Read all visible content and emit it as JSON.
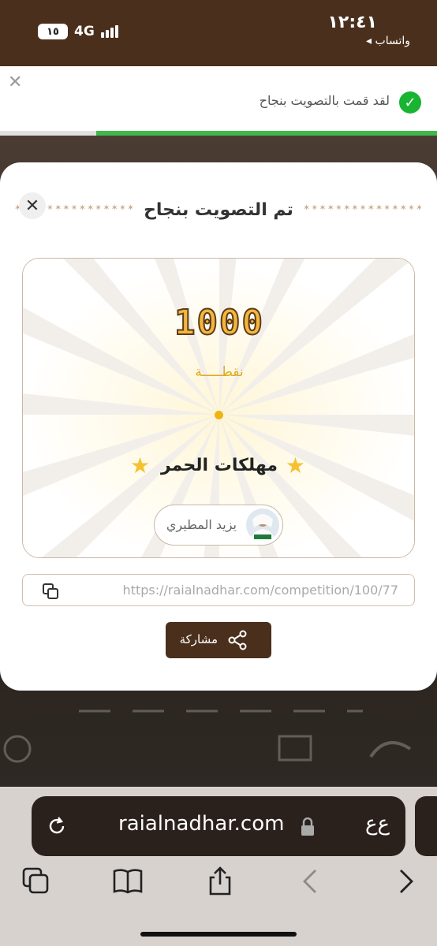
{
  "status_bar": {
    "time": "١٢:٤١",
    "back_app": "◂ واتساب",
    "battery": "١٥",
    "network": "4G"
  },
  "notification": {
    "message": "لقد قمت بالتصويت بنجاح",
    "progress_fraction": 0.78
  },
  "modal": {
    "title": "تم التصويت بنجاح",
    "points_value": "1000",
    "points_label": "نقطـــــة",
    "category": "مهلكات الحمر",
    "nominee_name": "يزيد المطيري",
    "link": "https://raialnadhar.com/competition/100/77",
    "share_label": "مشاركة"
  },
  "browser": {
    "url": "raialnadhar.com",
    "text_size_label": "ﻉﻉ"
  },
  "icons": {
    "notification_close": "close-icon",
    "notification_check": "check-icon",
    "modal_close": "close-icon",
    "star": "star-icon",
    "copy": "copy-icon",
    "share": "share-icon",
    "reload": "reload-icon",
    "lock": "lock-icon",
    "tabs": "tabs-icon",
    "bookmarks": "book-icon",
    "share_sheet": "share-sheet-icon",
    "back": "chevron-left-icon",
    "forward": "chevron-right-icon"
  },
  "colors": {
    "brand_brown": "#4a2f1c",
    "points_gold": "#f5b63c",
    "success_green": "#18b432"
  }
}
